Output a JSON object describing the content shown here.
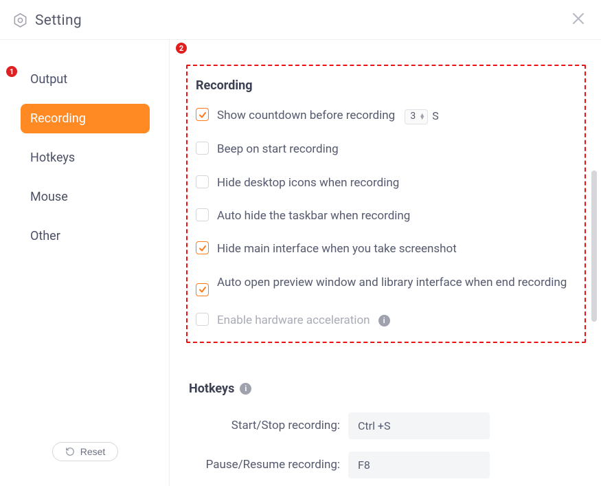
{
  "header": {
    "title": "Setting"
  },
  "sidebar": {
    "items": [
      {
        "label": "Output"
      },
      {
        "label": "Recording"
      },
      {
        "label": "Hotkeys"
      },
      {
        "label": "Mouse"
      },
      {
        "label": "Other"
      }
    ],
    "reset_label": "Reset"
  },
  "recording": {
    "section_title": "Recording",
    "options": {
      "countdown_label": "Show countdown before recording",
      "countdown_value": "3",
      "countdown_unit": "S",
      "beep_label": "Beep on start recording",
      "hide_icons_label": "Hide desktop icons when recording",
      "hide_taskbar_label": "Auto hide the taskbar when recording",
      "hide_main_label": "Hide main interface when you take screenshot",
      "auto_preview_label": "Auto open preview window and library interface when end recording",
      "hw_accel_label": "Enable hardware acceleration"
    }
  },
  "hotkeys": {
    "section_title": "Hotkeys",
    "rows": {
      "start_stop_label": "Start/Stop recording:",
      "start_stop_value": "Ctrl +S",
      "pause_resume_label": "Pause/Resume recording:",
      "pause_resume_value": "F8"
    }
  },
  "annotations": {
    "badge1": "1",
    "badge2": "2"
  }
}
